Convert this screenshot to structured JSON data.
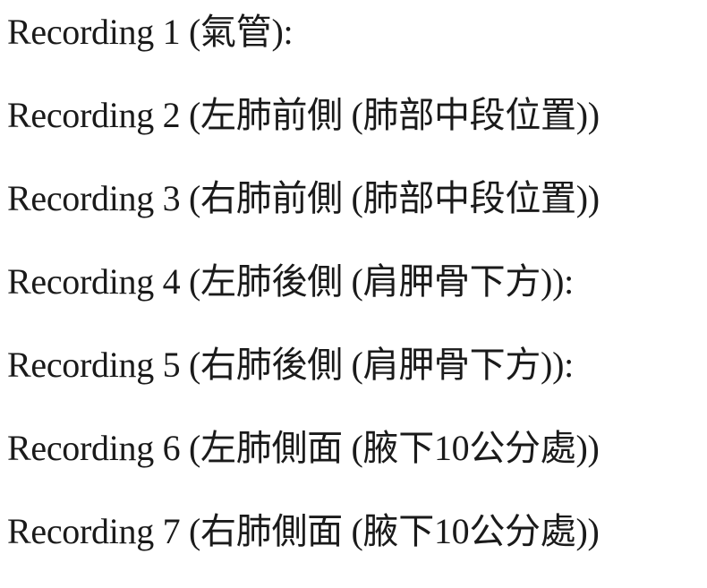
{
  "recordings": [
    {
      "text": "Recording 1 (氣管):"
    },
    {
      "text": "Recording 2 (左肺前側 (肺部中段位置))"
    },
    {
      "text": "Recording 3 (右肺前側 (肺部中段位置))"
    },
    {
      "text": "Recording 4 (左肺後側 (肩胛骨下方)):"
    },
    {
      "text": "Recording 5 (右肺後側 (肩胛骨下方)):"
    },
    {
      "text": "Recording 6 (左肺側面 (腋下10公分處))"
    },
    {
      "text": "Recording 7 (右肺側面 (腋下10公分處))"
    }
  ]
}
